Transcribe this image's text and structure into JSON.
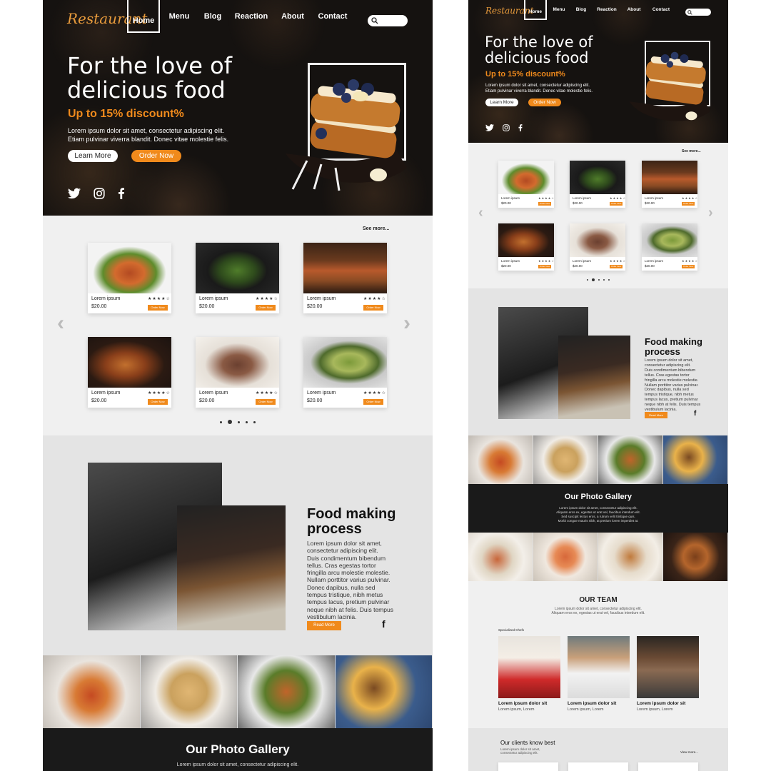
{
  "brand": {
    "logo": "Restaurant",
    "accent": "#f08a1c",
    "dark": "#151210"
  },
  "nav": {
    "items": [
      {
        "label": "Home",
        "active": true
      },
      {
        "label": "Menu"
      },
      {
        "label": "Blog"
      },
      {
        "label": "Reaction"
      },
      {
        "label": "About"
      },
      {
        "label": "Contact"
      }
    ]
  },
  "hero": {
    "headline_line1": "For the love of",
    "headline_line2": "delicious food",
    "discount": "Up to 15% discount%",
    "desc_line1": "Lorem ipsum dolor sit amet, consectetur adipiscing elit.",
    "desc_line2": "Etiam pulvinar viverra blandit. Donec vitae molestie felis.",
    "learn_more": "Learn More",
    "order_now": "Order Now",
    "socials": [
      "twitter-icon",
      "instagram-icon",
      "facebook-icon"
    ]
  },
  "menu": {
    "see_more": "See more...",
    "items": [
      {
        "name": "Lorem ipsum",
        "price": "$20.00",
        "stars": "★★★★☆",
        "order": "Order Now"
      },
      {
        "name": "Lorem ipsum",
        "price": "$20.00",
        "stars": "★★★★☆",
        "order": "Order Now"
      },
      {
        "name": "Lorem ipsum",
        "price": "$20.00",
        "stars": "★★★★☆",
        "order": "Order Now"
      },
      {
        "name": "Lorem ipsum",
        "price": "$20.00",
        "stars": "★★★★☆",
        "order": "Order Now"
      },
      {
        "name": "Lorem ipsum",
        "price": "$20.00",
        "stars": "★★★★☆",
        "order": "Order Now"
      },
      {
        "name": "Lorem ipsum",
        "price": "$20.00",
        "stars": "★★★★☆",
        "order": "Order Now"
      }
    ],
    "active_dot": 1
  },
  "process": {
    "title_line1": "Food making",
    "title_line2": "process",
    "text": [
      "Lorem ipsum dolor sit amet,",
      "consectetur adipiscing elit.",
      "Duis condimentum bibendum",
      "tellus. Cras egestas tortor",
      "fringilla arcu molestie molestie.",
      "Nullam porttitor varius pulvinar.",
      "Donec dapibus, nulla sed",
      "tempus tristique, nibh metus",
      "tempus lacus, pretium pulvinar",
      "neque nibh at felis. Duis tempus",
      "vestibulum lacinia."
    ],
    "read_more": "Read More"
  },
  "gallery": {
    "title": "Our Photo Gallery",
    "text": [
      "Lorem ipsum dolor sit amet, consectetur adipiscing elit.",
      "Aliquam eros ex, egestas ut erat vel, faucibus interdum elit.",
      "Sed suscipit lectus eros, a rutrum velit tristique quis.",
      "Morbi congue mauris nibh, at pretium lorem imperdiet at.",
      "Nullam pharetra eros in nibh feugiat, luctus mauris in justo."
    ]
  },
  "team": {
    "title": "OUR TEAM",
    "sub_line1": "Lorem ipsum dolor sit amet, consectetur adipiscing elit.",
    "sub_line2": "Aliquam eros ex, egestas ut erat vel, faucibus interdum elit.",
    "chefs_label": "Specialized Chefs",
    "members": [
      {
        "name": "Lorem ipsum dolor sit",
        "role": "Lorem ipsum, Lorem"
      },
      {
        "name": "Lorem ipsum dolor sit",
        "role": "Lorem ipsum, Lorem"
      },
      {
        "name": "Lorem ipsum dolor sit",
        "role": "Lorem ipsum, Lorem"
      }
    ]
  },
  "clients": {
    "title": "Our clients know best",
    "sub_line1": "Lorem ipsum dolor sit amet,",
    "sub_line2": "consectetur adipiscing elit.",
    "view_more": "View more..."
  }
}
